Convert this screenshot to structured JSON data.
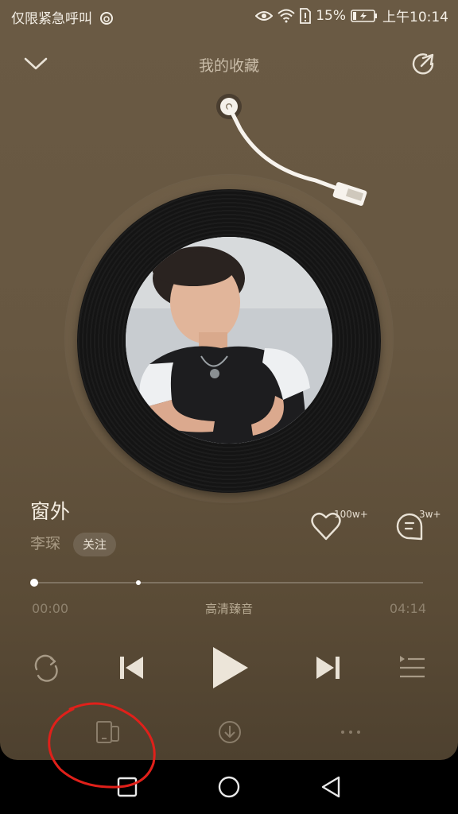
{
  "status_bar": {
    "left_text": "仅限紧急呼叫",
    "battery": "15%",
    "time": "上午10:14"
  },
  "header": {
    "title": "我的收藏",
    "back_icon": "chevron-down-icon",
    "share_icon": "share-icon"
  },
  "song": {
    "title": "窗外",
    "artist": "李琛",
    "follow_label": "关注",
    "like_count": "100w+",
    "comment_count": "3w+"
  },
  "progress": {
    "current": "00:00",
    "total": "04:14",
    "quality": "高清臻音",
    "played_fraction": 0.0,
    "buffered_fraction": 0.27
  },
  "controls": {
    "repeat_icon": "repeat-icon",
    "prev_icon": "previous-icon",
    "play_icon": "play-icon",
    "next_icon": "next-icon",
    "playlist_icon": "playlist-icon"
  },
  "actions": {
    "device_icon": "device-switch-icon",
    "download_icon": "download-icon",
    "more_icon": "more-icon"
  },
  "colors": {
    "background": "#675741",
    "annotation": "#e0201a"
  }
}
